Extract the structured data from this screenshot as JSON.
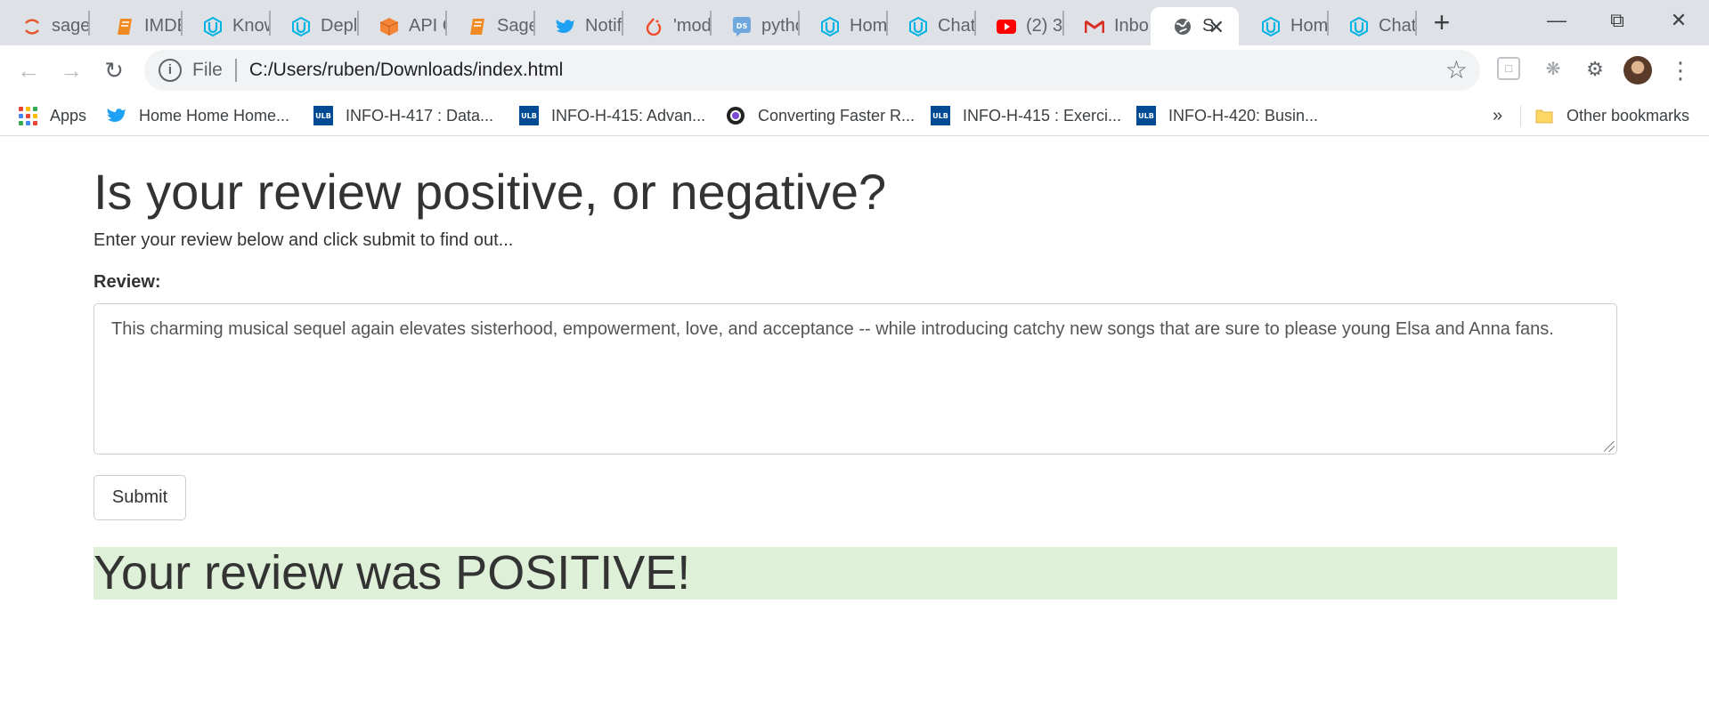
{
  "browser": {
    "tabs": [
      {
        "title": "sage",
        "icon": "sagemaker-icon",
        "icon_color": "#e8552b",
        "active": false
      },
      {
        "title": "IMDB",
        "icon": "notebook-icon",
        "icon_color": "#f08a24",
        "active": false
      },
      {
        "title": "Know",
        "icon": "udacity-icon",
        "icon_color": "#02b3e4",
        "active": false
      },
      {
        "title": "Depl",
        "icon": "udacity-icon",
        "icon_color": "#02b3e4",
        "active": false
      },
      {
        "title": "API G",
        "icon": "aws-cube-icon",
        "icon_color": "#f58536",
        "active": false
      },
      {
        "title": "Sage",
        "icon": "notebook-icon",
        "icon_color": "#f08a24",
        "active": false
      },
      {
        "title": "Notif",
        "icon": "twitter-icon",
        "icon_color": "#1da1f2",
        "active": false
      },
      {
        "title": "'mod",
        "icon": "pytorch-icon",
        "icon_color": "#ee4c2c",
        "active": false
      },
      {
        "title": "pytho",
        "icon": "ds-icon",
        "icon_color": "#5b9bd5",
        "active": false
      },
      {
        "title": "Hom",
        "icon": "udacity-icon",
        "icon_color": "#02b3e4",
        "active": false
      },
      {
        "title": "Chat",
        "icon": "udacity-icon",
        "icon_color": "#02b3e4",
        "active": false
      },
      {
        "title": "(2) 3",
        "icon": "youtube-icon",
        "icon_color": "#ff0000",
        "active": false
      },
      {
        "title": "Inbo",
        "icon": "gmail-icon",
        "icon_color": "#d93025",
        "active": false
      },
      {
        "title": "S",
        "icon": "globe-icon",
        "icon_color": "#5f6368",
        "active": true
      },
      {
        "title": "Hom",
        "icon": "udacity-icon",
        "icon_color": "#02b3e4",
        "active": false
      },
      {
        "title": "Chat",
        "icon": "udacity-icon",
        "icon_color": "#02b3e4",
        "active": false
      }
    ],
    "new_tab_glyph": "+",
    "omnibox": {
      "scheme": "File",
      "url": "C:/Users/ruben/Downloads/index.html"
    },
    "bookmarks": [
      {
        "label": "Apps",
        "icon": "apps-grid-icon"
      },
      {
        "label": "Home Home Home...",
        "icon": "twitter-icon"
      },
      {
        "label": "INFO-H-417 : Data...",
        "icon": "ulb-icon"
      },
      {
        "label": "INFO-H-415: Advan...",
        "icon": "ulb-icon"
      },
      {
        "label": "Converting Faster R...",
        "icon": "eye-logo-icon"
      },
      {
        "label": "INFO-H-415 : Exerci...",
        "icon": "ulb-icon"
      },
      {
        "label": "INFO-H-420: Busin...",
        "icon": "ulb-icon"
      }
    ],
    "bookmarks_overflow": "»",
    "other_bookmarks": "Other bookmarks",
    "ulb_badge_text": "ULB"
  },
  "page": {
    "title": "Is your review positive, or negative?",
    "subtitle": "Enter your review below and click submit to find out...",
    "review_label": "Review:",
    "review_text": "This charming musical sequel again elevates sisterhood, empowerment, love, and acceptance -- while introducing catchy new songs that are sure to please young Elsa and Anna fans.",
    "submit_label": "Submit",
    "result": "Your review was POSITIVE!",
    "result_color": "#dff0d8"
  }
}
